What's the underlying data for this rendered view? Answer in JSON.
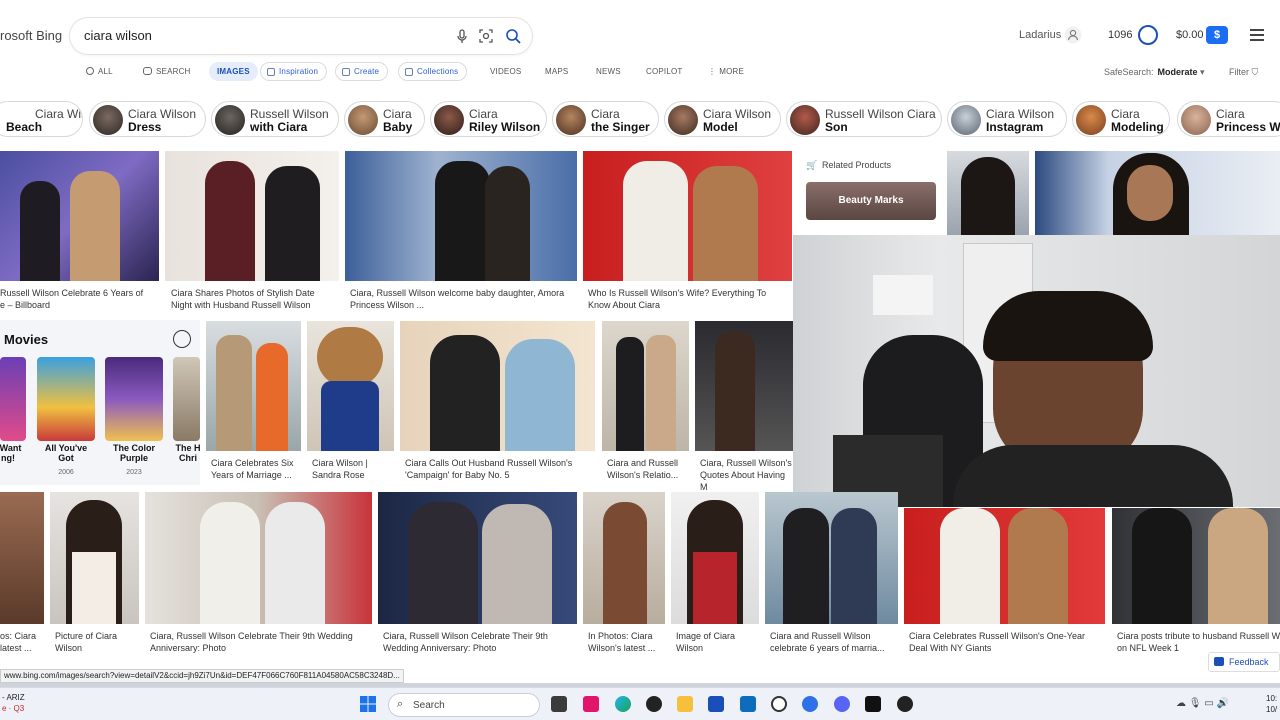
{
  "header": {
    "brand": "rosoft Bing",
    "search_value": "ciara wilson",
    "user_name": "Ladarius",
    "points": "1096",
    "money": "$0.00",
    "money_badge": "$"
  },
  "nav": {
    "items": [
      "ALL",
      "SEARCH",
      "IMAGES",
      "Inspiration",
      "Create",
      "Collections",
      "VIDEOS",
      "MAPS",
      "NEWS",
      "COPILOT",
      "MORE"
    ],
    "safesearch_label": "SafeSearch:",
    "safesearch_value": "Moderate",
    "filter_label": "Filter"
  },
  "chips": [
    {
      "l1": "Ciara Wilson",
      "l2": "Beach"
    },
    {
      "l1": "Ciara Wilson",
      "l2": "Dress"
    },
    {
      "l1": "Russell Wilson",
      "l2": "with Ciara"
    },
    {
      "l1": "Ciara",
      "l2": "Baby"
    },
    {
      "l1": "Ciara",
      "l2": "Riley Wilson"
    },
    {
      "l1": "Ciara",
      "l2": "the Singer"
    },
    {
      "l1": "Ciara Wilson",
      "l2": "Model"
    },
    {
      "l1": "Russell Wilson Ciara",
      "l2": "Son"
    },
    {
      "l1": "Ciara Wilson",
      "l2": "Instagram"
    },
    {
      "l1": "Ciara",
      "l2": "Modeling"
    },
    {
      "l1": "Ciara",
      "l2": "Princess Wi"
    }
  ],
  "row1_captions": [
    "Russell Wilson Celebrate 6 Years of\ne – Billboard",
    "Ciara Shares Photos of Stylish Date\nNight with Husband Russell Wilson",
    "Ciara, Russell Wilson welcome baby daughter, Amora\nPrincess Wilson ...",
    "Who Is Russell Wilson's Wife? Everything To\nKnow About Ciara"
  ],
  "related_products": {
    "title": "Related Products",
    "tile": "Beauty Marks"
  },
  "movies": {
    "title": "Movies",
    "items": [
      {
        "title": "I Want\nng!",
        "year": ""
      },
      {
        "title": "All You've\nGot",
        "year": "2006"
      },
      {
        "title": "The Color\nPurple",
        "year": "2023"
      },
      {
        "title": "The H\nChri",
        "year": ""
      }
    ]
  },
  "row2_captions": [
    "Ciara Celebrates Six\nYears of Marriage ...",
    "Ciara Wilson |\nSandra Rose",
    "Ciara Calls Out Husband Russell Wilson's\n'Campaign' for Baby No. 5",
    "Ciara and Russell\nWilson's Relatio...",
    "Ciara, Russell Wilson's\nQuotes About Having M"
  ],
  "row3_captions": [
    "os: Ciara\nlatest ...",
    "Picture of Ciara\nWilson",
    "Ciara, Russell Wilson Celebrate Their 9th Wedding\nAnniversary: Photo",
    "Ciara, Russell Wilson Celebrate Their 9th\nWedding Anniversary: Photo",
    "In Photos: Ciara\nWilson's latest ...",
    "Image of Ciara\nWilson",
    "Ciara and Russell Wilson\ncelebrate 6 years of marria...",
    "Ciara Celebrates Russell Wilson's One-Year\nDeal With NY Giants",
    "Ciara posts tribute to husband Russell W\non NFL Week 1"
  ],
  "status_url": "www.bing.com/images/search?view=detailV2&ccid=jh9Zi7Un&id=DEF47F066C760F811A04580AC58C3248D...",
  "feedback": "Feedback",
  "taskbar": {
    "search": "Search",
    "weather_line1": "- ARIZ",
    "weather_line2": "e · Q3",
    "clock_line1": "10:",
    "clock_line2": "10/"
  }
}
